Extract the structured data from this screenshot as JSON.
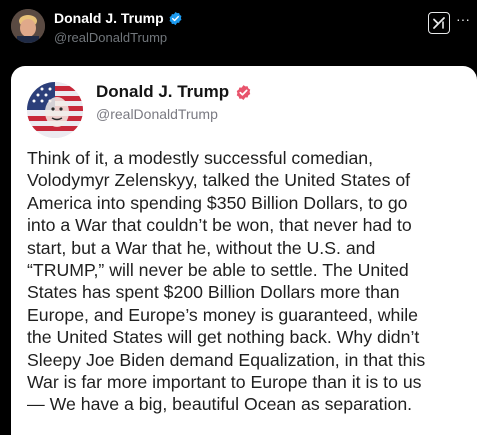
{
  "x_post": {
    "author_name": "Donald J. Trump",
    "author_handle": "@realDonaldTrump",
    "more_label": "···",
    "verified_color": "#1d9bf0"
  },
  "embedded_post": {
    "author_name": "Donald J. Trump",
    "author_handle": "@realDonaldTrump",
    "verified_color": "#e8546c",
    "body": "Think of it, a modestly successful comedian,\nVolodymyr Zelenskyy, talked the United States of\nAmerica into spending $350 Billion Dollars, to go\ninto a War that couldn’t be won, that never had to\nstart, but a War that he, without the U.S. and\n“TRUMP,” will never be able to settle. The United\nStates has spent $200 Billion Dollars more than\nEurope, and Europe’s money is guaranteed, while\nthe United States will get nothing back. Why didn’t\nSleepy Joe Biden demand Equalization, in that this\nWar is far more important to Europe than it is to us\n— We have a big, beautiful Ocean as separation."
  },
  "icons": {
    "verified": "verified-badge-icon",
    "grok": "grok-icon",
    "more": "more-icon"
  }
}
